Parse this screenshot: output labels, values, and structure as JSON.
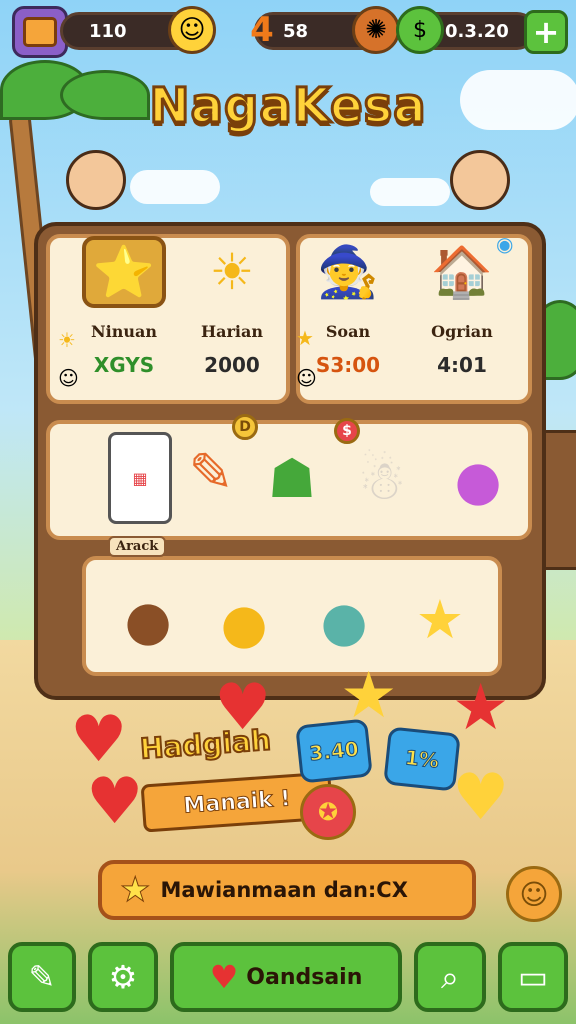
{
  "game": {
    "title": "NagaKesa"
  },
  "topbar": {
    "currency1": {
      "value": "110",
      "icon": "smiley-coin-icon"
    },
    "currency2": {
      "value": "58",
      "icon": "gear-coin-icon"
    },
    "currency3": {
      "value": "0.3.20",
      "icon": "cash-icon"
    },
    "plus_label": "+"
  },
  "shop": {
    "row1": [
      {
        "label": "Ninuan",
        "value": "XGYS",
        "value_color": "#2f8f2a",
        "icon": "star-sticker-icon"
      },
      {
        "label": "Harian",
        "value": "2000",
        "value_color": "#2b2b2b",
        "icon": "sun-icon"
      },
      {
        "label": "Soan",
        "value": "S3:00",
        "value_color": "#d6540f",
        "icon": "shaman-icon"
      },
      {
        "label": "Ogrian",
        "value": "4:01",
        "value_color": "#2b2b2b",
        "icon": "house-icon"
      }
    ],
    "section_label": "Arack",
    "coin_marks": [
      "D",
      "$"
    ]
  },
  "reward": {
    "title": "Hadgiah",
    "subtitle": "Manaik !",
    "tag1": "3.40",
    "tag2": "1%"
  },
  "cta": {
    "label": "Mawianmaan dan:CX"
  },
  "nav": {
    "center_label": "Oandsain"
  },
  "colors": {
    "accent": "#f5a53a",
    "nav_green": "#5cc23d",
    "board_brown": "#8a5a33"
  }
}
